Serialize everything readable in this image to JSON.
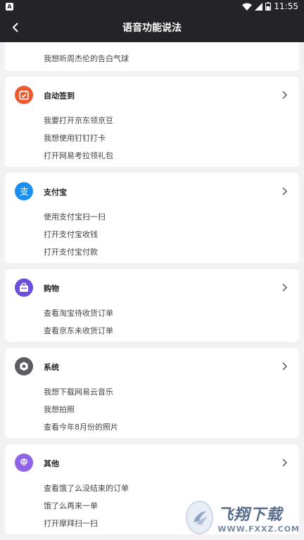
{
  "status_bar": {
    "app_icon_letter": "A",
    "time": "11:55"
  },
  "nav": {
    "title": "语音功能说法"
  },
  "top_card": {
    "item": "我想听周杰伦的告白气球"
  },
  "categories": [
    {
      "title": "自动签到",
      "icon": "calendar-check-icon",
      "color": "#ec5a2f",
      "items": [
        "我要打开京东领京豆",
        "我想使用钉钉打卡",
        "打开网易考拉领礼包"
      ]
    },
    {
      "title": "支付宝",
      "icon": "alipay-icon",
      "color": "#1b8ff0",
      "items": [
        "使用支付宝扫一扫",
        "打开支付宝收钱",
        "打开支付宝付款"
      ]
    },
    {
      "title": "购物",
      "icon": "shopping-bag-icon",
      "color": "#6b4fd8",
      "items": [
        "查看淘宝待收货订单",
        "查看京东未收货订单"
      ]
    },
    {
      "title": "系统",
      "icon": "gear-icon",
      "color": "#5c5c62",
      "items": [
        "我想下载网易云音乐",
        "我想拍照",
        "查看今年8月份的照片"
      ]
    },
    {
      "title": "其他",
      "icon": "diamond-icon",
      "color": "#8e63e6",
      "items": [
        "查看饿了么没结束的订单",
        "饿了么再来一单",
        "打开摩拜扫一扫"
      ]
    }
  ],
  "watermark": {
    "main": "飞翔下载",
    "sub": "WWW.FXXZ.COM"
  }
}
